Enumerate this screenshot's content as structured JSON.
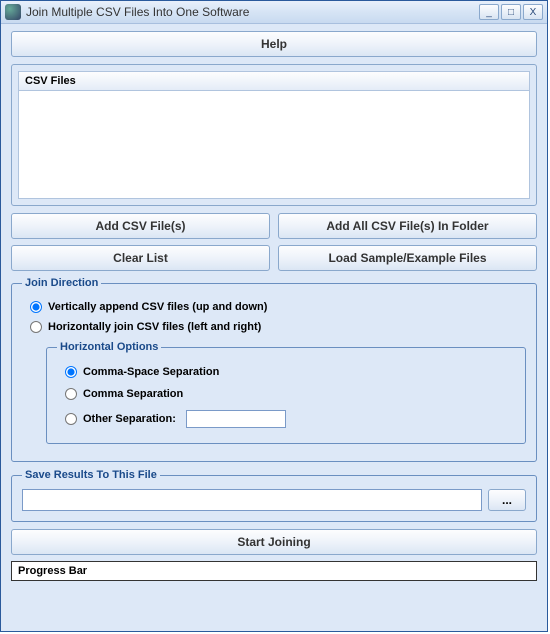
{
  "window": {
    "title": "Join Multiple CSV Files Into One Software",
    "minimize": "_",
    "maximize": "□",
    "close": "X"
  },
  "help_button": "Help",
  "csv_list": {
    "header": "CSV Files"
  },
  "buttons": {
    "add_csv": "Add CSV File(s)",
    "add_folder": "Add All CSV File(s) In Folder",
    "clear_list": "Clear List",
    "load_sample": "Load Sample/Example Files"
  },
  "join_direction": {
    "legend": "Join Direction",
    "vertical": "Vertically append CSV files (up and down)",
    "horizontal": "Horizontally join CSV files (left and right)",
    "selected": "vertical"
  },
  "horizontal_options": {
    "legend": "Horizontal Options",
    "comma_space": "Comma-Space Separation",
    "comma": "Comma Separation",
    "other_label": "Other Separation:",
    "other_value": "",
    "selected": "comma_space"
  },
  "save_section": {
    "legend": "Save Results To This File",
    "path": "",
    "browse": "..."
  },
  "start_button": "Start Joining",
  "progress_label": "Progress Bar"
}
